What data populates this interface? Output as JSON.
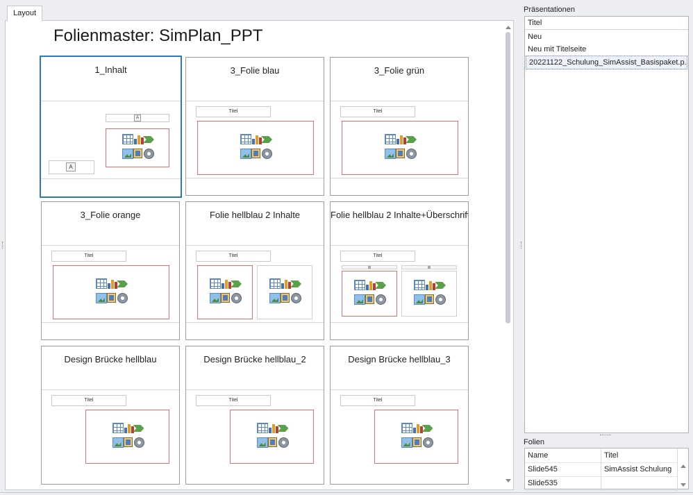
{
  "layout_tab": {
    "label": "Layout"
  },
  "master_title": "Folienmaster: SimPlan_PPT",
  "placeholder_title": "Titel",
  "placeholder_text_glyph": "A",
  "cards": [
    {
      "title": "1_Inhalt",
      "selected": true
    },
    {
      "title": "3_Folie blau"
    },
    {
      "title": "3_Folie grün"
    },
    {
      "title": "3_Folie orange"
    },
    {
      "title": "Folie hellblau 2 Inhalte"
    },
    {
      "title": "Folie hellblau 2 Inhalte+Überschrift"
    },
    {
      "title": "Design Brücke hellblau"
    },
    {
      "title": "Design Brücke hellblau_2"
    },
    {
      "title": "Design Brücke hellblau_3"
    }
  ],
  "presentations": {
    "label": "Präsentationen",
    "column": "Titel",
    "items": [
      "Neu",
      "Neu mit Titelseite",
      "20221122_Schulung_SimAssist_Basispaket.p..."
    ],
    "selected_index": 2
  },
  "slides": {
    "label": "Folien",
    "columns": [
      "Name",
      "Titel"
    ],
    "rows": [
      {
        "name": "Slide545",
        "title": "SimAssist Schulung"
      },
      {
        "name": "Slide535",
        "title": ""
      }
    ]
  },
  "colors": {
    "selection_border": "#2b79b3",
    "content_placeholder_border": "#e07070"
  }
}
